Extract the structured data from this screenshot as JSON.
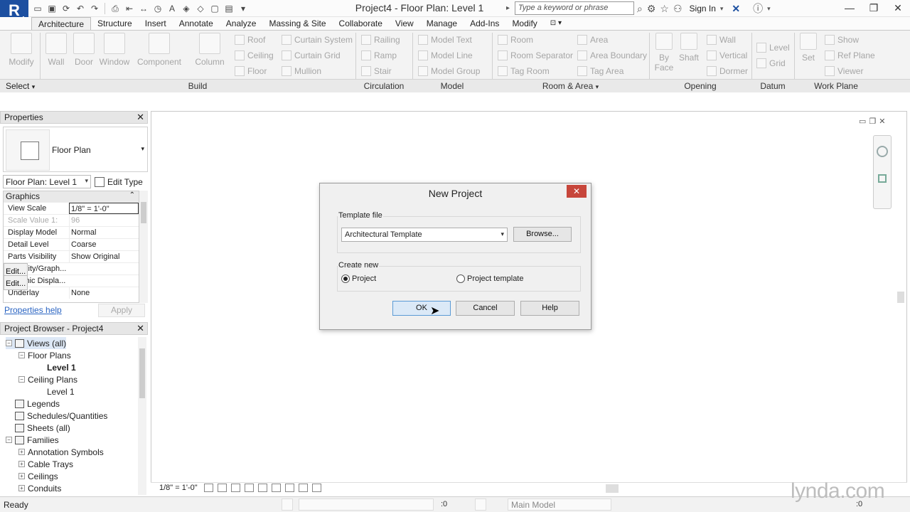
{
  "titlebar": {
    "title": "Project4 - Floor Plan: Level 1",
    "search_placeholder": "Type a keyword or phrase",
    "sign_in": "Sign In",
    "app_letter": "R",
    "app_sub": "A"
  },
  "ribbon": {
    "tabs": [
      "Architecture",
      "Structure",
      "Insert",
      "Annotate",
      "Analyze",
      "Massing & Site",
      "Collaborate",
      "View",
      "Manage",
      "Add-Ins",
      "Modify"
    ],
    "select_label": "Select",
    "panels": [
      "Build",
      "Circulation",
      "Model",
      "Room & Area",
      "Opening",
      "Datum",
      "Work Plane"
    ],
    "build_big": [
      "Modify",
      "Wall",
      "Door",
      "Window",
      "Component",
      "Column"
    ],
    "build_small": [
      "Roof",
      "Ceiling",
      "Floor",
      "Curtain System",
      "Curtain Grid",
      "Mullion"
    ],
    "circulation": [
      "Railing",
      "Ramp",
      "Stair"
    ],
    "model": [
      "Model Text",
      "Model Line",
      "Model Group"
    ],
    "room": [
      "Room",
      "Room Separator",
      "Tag Room",
      "Area",
      "Area Boundary",
      "Tag Area"
    ],
    "opening_big": [
      "By Face",
      "Shaft"
    ],
    "opening_small": [
      "Wall",
      "Vertical",
      "Dormer"
    ],
    "datum": [
      "Level",
      "Grid"
    ],
    "work_plane_big": "Set",
    "work_plane_small": [
      "Show",
      "Ref Plane",
      "Viewer"
    ]
  },
  "properties": {
    "header": "Properties",
    "type_name": "Floor Plan",
    "view_selector": "Floor Plan: Level 1",
    "edit_type": "Edit Type",
    "section": "Graphics",
    "rows": [
      {
        "key": "View Scale",
        "value": "1/8\" = 1'-0\""
      },
      {
        "key": "Scale Value    1:",
        "value": "96"
      },
      {
        "key": "Display Model",
        "value": "Normal"
      },
      {
        "key": "Detail Level",
        "value": "Coarse"
      },
      {
        "key": "Parts Visibility",
        "value": "Show Original"
      },
      {
        "key": "Visibility/Graph...",
        "value": "Edit..."
      },
      {
        "key": "Graphic Displa...",
        "value": "Edit..."
      },
      {
        "key": "Underlay",
        "value": "None"
      }
    ],
    "help_link": "Properties help",
    "apply": "Apply"
  },
  "browser": {
    "header": "Project Browser - Project4",
    "nodes": [
      "Views (all)",
      "Floor Plans",
      "Level 1",
      "Ceiling Plans",
      "Level 1",
      "Legends",
      "Schedules/Quantities",
      "Sheets (all)",
      "Families",
      "Annotation Symbols",
      "Cable Trays",
      "Ceilings",
      "Conduits"
    ]
  },
  "dialog": {
    "title": "New Project",
    "template_group": "Template file",
    "template_value": "Architectural Template",
    "browse": "Browse...",
    "create_group": "Create new",
    "radio_project": "Project",
    "radio_template": "Project template",
    "selected": "Project",
    "ok": "OK",
    "cancel": "Cancel",
    "help": "Help"
  },
  "viewbar": {
    "scale": "1/8\" = 1'-0\""
  },
  "status": {
    "ready": "Ready",
    "zero1": ":0",
    "model": "Main Model",
    "zero2": ":0"
  },
  "watermark": "lynda.com"
}
